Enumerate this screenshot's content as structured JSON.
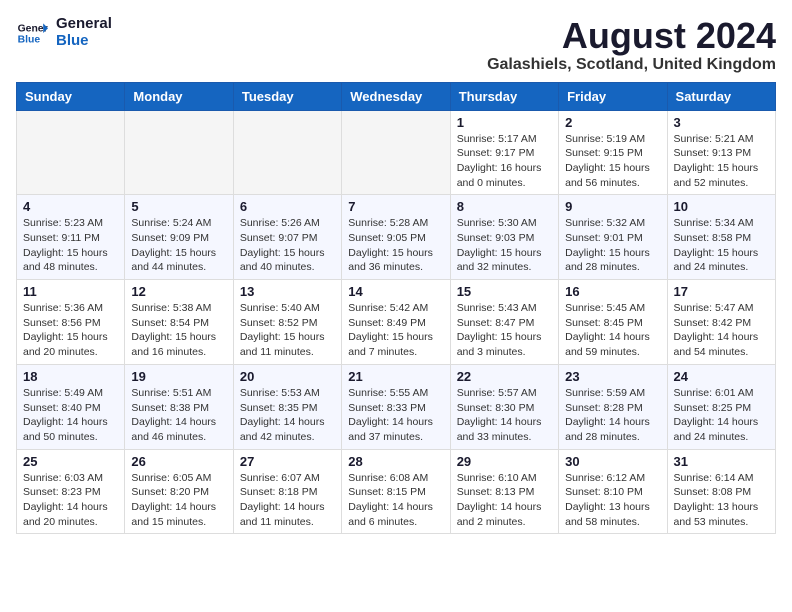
{
  "logo": {
    "line1": "General",
    "line2": "Blue"
  },
  "title": "August 2024",
  "subtitle": "Galashiels, Scotland, United Kingdom",
  "days_of_week": [
    "Sunday",
    "Monday",
    "Tuesday",
    "Wednesday",
    "Thursday",
    "Friday",
    "Saturday"
  ],
  "weeks": [
    [
      {
        "day": "",
        "info": ""
      },
      {
        "day": "",
        "info": ""
      },
      {
        "day": "",
        "info": ""
      },
      {
        "day": "",
        "info": ""
      },
      {
        "day": "1",
        "info": "Sunrise: 5:17 AM\nSunset: 9:17 PM\nDaylight: 16 hours\nand 0 minutes."
      },
      {
        "day": "2",
        "info": "Sunrise: 5:19 AM\nSunset: 9:15 PM\nDaylight: 15 hours\nand 56 minutes."
      },
      {
        "day": "3",
        "info": "Sunrise: 5:21 AM\nSunset: 9:13 PM\nDaylight: 15 hours\nand 52 minutes."
      }
    ],
    [
      {
        "day": "4",
        "info": "Sunrise: 5:23 AM\nSunset: 9:11 PM\nDaylight: 15 hours\nand 48 minutes."
      },
      {
        "day": "5",
        "info": "Sunrise: 5:24 AM\nSunset: 9:09 PM\nDaylight: 15 hours\nand 44 minutes."
      },
      {
        "day": "6",
        "info": "Sunrise: 5:26 AM\nSunset: 9:07 PM\nDaylight: 15 hours\nand 40 minutes."
      },
      {
        "day": "7",
        "info": "Sunrise: 5:28 AM\nSunset: 9:05 PM\nDaylight: 15 hours\nand 36 minutes."
      },
      {
        "day": "8",
        "info": "Sunrise: 5:30 AM\nSunset: 9:03 PM\nDaylight: 15 hours\nand 32 minutes."
      },
      {
        "day": "9",
        "info": "Sunrise: 5:32 AM\nSunset: 9:01 PM\nDaylight: 15 hours\nand 28 minutes."
      },
      {
        "day": "10",
        "info": "Sunrise: 5:34 AM\nSunset: 8:58 PM\nDaylight: 15 hours\nand 24 minutes."
      }
    ],
    [
      {
        "day": "11",
        "info": "Sunrise: 5:36 AM\nSunset: 8:56 PM\nDaylight: 15 hours\nand 20 minutes."
      },
      {
        "day": "12",
        "info": "Sunrise: 5:38 AM\nSunset: 8:54 PM\nDaylight: 15 hours\nand 16 minutes."
      },
      {
        "day": "13",
        "info": "Sunrise: 5:40 AM\nSunset: 8:52 PM\nDaylight: 15 hours\nand 11 minutes."
      },
      {
        "day": "14",
        "info": "Sunrise: 5:42 AM\nSunset: 8:49 PM\nDaylight: 15 hours\nand 7 minutes."
      },
      {
        "day": "15",
        "info": "Sunrise: 5:43 AM\nSunset: 8:47 PM\nDaylight: 15 hours\nand 3 minutes."
      },
      {
        "day": "16",
        "info": "Sunrise: 5:45 AM\nSunset: 8:45 PM\nDaylight: 14 hours\nand 59 minutes."
      },
      {
        "day": "17",
        "info": "Sunrise: 5:47 AM\nSunset: 8:42 PM\nDaylight: 14 hours\nand 54 minutes."
      }
    ],
    [
      {
        "day": "18",
        "info": "Sunrise: 5:49 AM\nSunset: 8:40 PM\nDaylight: 14 hours\nand 50 minutes."
      },
      {
        "day": "19",
        "info": "Sunrise: 5:51 AM\nSunset: 8:38 PM\nDaylight: 14 hours\nand 46 minutes."
      },
      {
        "day": "20",
        "info": "Sunrise: 5:53 AM\nSunset: 8:35 PM\nDaylight: 14 hours\nand 42 minutes."
      },
      {
        "day": "21",
        "info": "Sunrise: 5:55 AM\nSunset: 8:33 PM\nDaylight: 14 hours\nand 37 minutes."
      },
      {
        "day": "22",
        "info": "Sunrise: 5:57 AM\nSunset: 8:30 PM\nDaylight: 14 hours\nand 33 minutes."
      },
      {
        "day": "23",
        "info": "Sunrise: 5:59 AM\nSunset: 8:28 PM\nDaylight: 14 hours\nand 28 minutes."
      },
      {
        "day": "24",
        "info": "Sunrise: 6:01 AM\nSunset: 8:25 PM\nDaylight: 14 hours\nand 24 minutes."
      }
    ],
    [
      {
        "day": "25",
        "info": "Sunrise: 6:03 AM\nSunset: 8:23 PM\nDaylight: 14 hours\nand 20 minutes."
      },
      {
        "day": "26",
        "info": "Sunrise: 6:05 AM\nSunset: 8:20 PM\nDaylight: 14 hours\nand 15 minutes."
      },
      {
        "day": "27",
        "info": "Sunrise: 6:07 AM\nSunset: 8:18 PM\nDaylight: 14 hours\nand 11 minutes."
      },
      {
        "day": "28",
        "info": "Sunrise: 6:08 AM\nSunset: 8:15 PM\nDaylight: 14 hours\nand 6 minutes."
      },
      {
        "day": "29",
        "info": "Sunrise: 6:10 AM\nSunset: 8:13 PM\nDaylight: 14 hours\nand 2 minutes."
      },
      {
        "day": "30",
        "info": "Sunrise: 6:12 AM\nSunset: 8:10 PM\nDaylight: 13 hours\nand 58 minutes."
      },
      {
        "day": "31",
        "info": "Sunrise: 6:14 AM\nSunset: 8:08 PM\nDaylight: 13 hours\nand 53 minutes."
      }
    ]
  ]
}
